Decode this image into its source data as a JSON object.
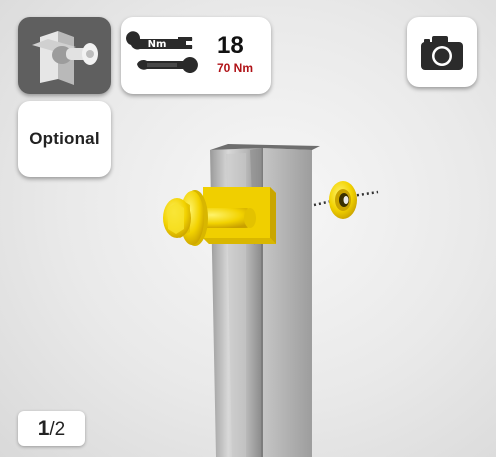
{
  "torque": {
    "count": "18",
    "value": "70 Nm",
    "unit_tag": "Nm"
  },
  "optional_label": "Optional",
  "pagination": {
    "current": "1",
    "total": "/2"
  },
  "icons": {
    "part": "bracket-bolt-icon",
    "torque": "wrench-icon",
    "camera": "camera-icon"
  },
  "colors": {
    "accent_red": "#b01217",
    "part_yellow": "#f5d000",
    "part_tile_bg": "#5f5f5f"
  }
}
